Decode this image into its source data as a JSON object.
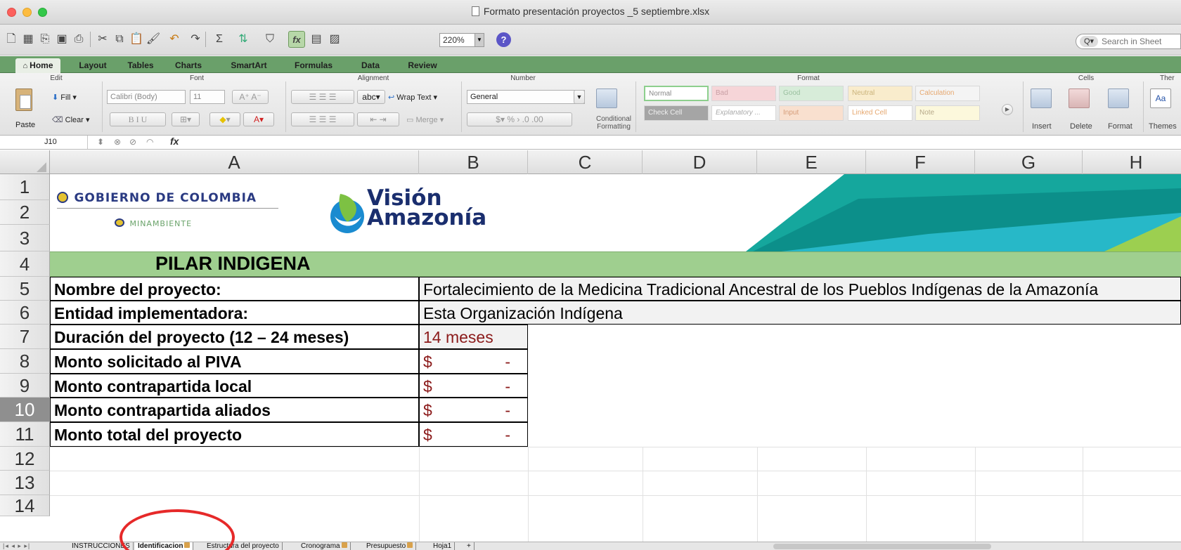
{
  "window": {
    "title": "Formato presentación proyectos _5 septiembre.xlsx"
  },
  "toolbar": {
    "zoom": "220%",
    "search_placeholder": "Search in Sheet",
    "help_label": "?",
    "search_glyph": "Q▾"
  },
  "ribbon_tabs": [
    "Home",
    "Layout",
    "Tables",
    "Charts",
    "SmartArt",
    "Formulas",
    "Data",
    "Review"
  ],
  "ribbon": {
    "groups": {
      "edit": "Edit",
      "font": "Font",
      "alignment": "Alignment",
      "number": "Number",
      "format": "Format",
      "cells": "Cells",
      "themes": "Ther"
    },
    "fill_label": "Fill",
    "clear_label": "Clear",
    "paste_label": "Paste",
    "font_name": "Calibri (Body)",
    "font_size": "11",
    "wrap_text_label": "Wrap Text",
    "merge_label": "Merge",
    "abc_label": "abc",
    "number_format": "General",
    "conditional_formatting_label": "Conditional Formatting",
    "styles": [
      {
        "label": "Normal",
        "bg": "#ffffff",
        "fg": "#888888"
      },
      {
        "label": "Bad",
        "bg": "#f6d5d8",
        "fg": "#c9a0a5"
      },
      {
        "label": "Good",
        "bg": "#d7ecd9",
        "fg": "#9bc1a0"
      },
      {
        "label": "Neutral",
        "bg": "#f9eccc",
        "fg": "#cbb47c"
      },
      {
        "label": "Calculation",
        "bg": "#f4f4f4",
        "fg": "#e6a870"
      },
      {
        "label": "Check Cell",
        "bg": "#a5a5a5",
        "fg": "#f0f0f0"
      },
      {
        "label": "Explanatory ...",
        "bg": "#ffffff",
        "fg": "#aaaaaa"
      },
      {
        "label": "Input",
        "bg": "#f9e0cf",
        "fg": "#d59c79"
      },
      {
        "label": "Linked Cell",
        "bg": "#ffffff",
        "fg": "#e6a870"
      },
      {
        "label": "Note",
        "bg": "#fcf8dc",
        "fg": "#b7a98a"
      }
    ],
    "cells_buttons": [
      "Insert",
      "Delete",
      "Format"
    ],
    "themes_label": "Themes"
  },
  "formula_bar": {
    "name_box": "J10",
    "fx": "fx",
    "content": ""
  },
  "columns": [
    "A",
    "B",
    "C",
    "D",
    "E",
    "F",
    "G",
    "H"
  ],
  "rows": [
    "1",
    "2",
    "3",
    "4",
    "5",
    "6",
    "7",
    "8",
    "9",
    "10",
    "11",
    "12",
    "13",
    "14"
  ],
  "selected_row": "10",
  "logos": {
    "gov": "GOBIERNO DE COLOMBIA",
    "minambiente": "MINAMBIENTE",
    "vision_line1": "Visión",
    "vision_line2": "Amazonía"
  },
  "sheet": {
    "banner": "PILAR INDIGENA",
    "fields": [
      {
        "label": "Nombre del proyecto:",
        "value": "Fortalecimiento de la Medicina Tradicional Ancestral de los Pueblos Indígenas de la Amazonía"
      },
      {
        "label": "Entidad implementadora:",
        "value": "Esta Organización Indígena"
      },
      {
        "label": "Duración del proyecto (12 – 24 meses)",
        "value": "14 meses"
      },
      {
        "label": "Monto solicitado al PIVA",
        "currency": "$",
        "amount": "-"
      },
      {
        "label": "Monto contrapartida local",
        "currency": "$",
        "amount": "-"
      },
      {
        "label": "Monto contrapartida aliados",
        "currency": "$",
        "amount": "-"
      },
      {
        "label": "Monto total del proyecto",
        "currency": "$",
        "amount": "-"
      }
    ]
  },
  "sheet_tabs": [
    {
      "label": "INSTRUCCIONES",
      "locked": false,
      "active": false
    },
    {
      "label": "Identificacion",
      "locked": true,
      "active": true
    },
    {
      "label": "Estructura del proyecto",
      "locked": false,
      "active": false
    },
    {
      "label": "Cronograma",
      "locked": true,
      "active": false
    },
    {
      "label": "Presupuesto",
      "locked": true,
      "active": false
    },
    {
      "label": "Hoja1",
      "locked": false,
      "active": false
    }
  ],
  "add_sheet_label": "+",
  "colors": {
    "banner_green": "#9fcf8f",
    "tab_green": "#6aa06a",
    "accent_red": "#8b1a1a",
    "teal": "#0e9a93",
    "annotation_red": "#e62929"
  }
}
